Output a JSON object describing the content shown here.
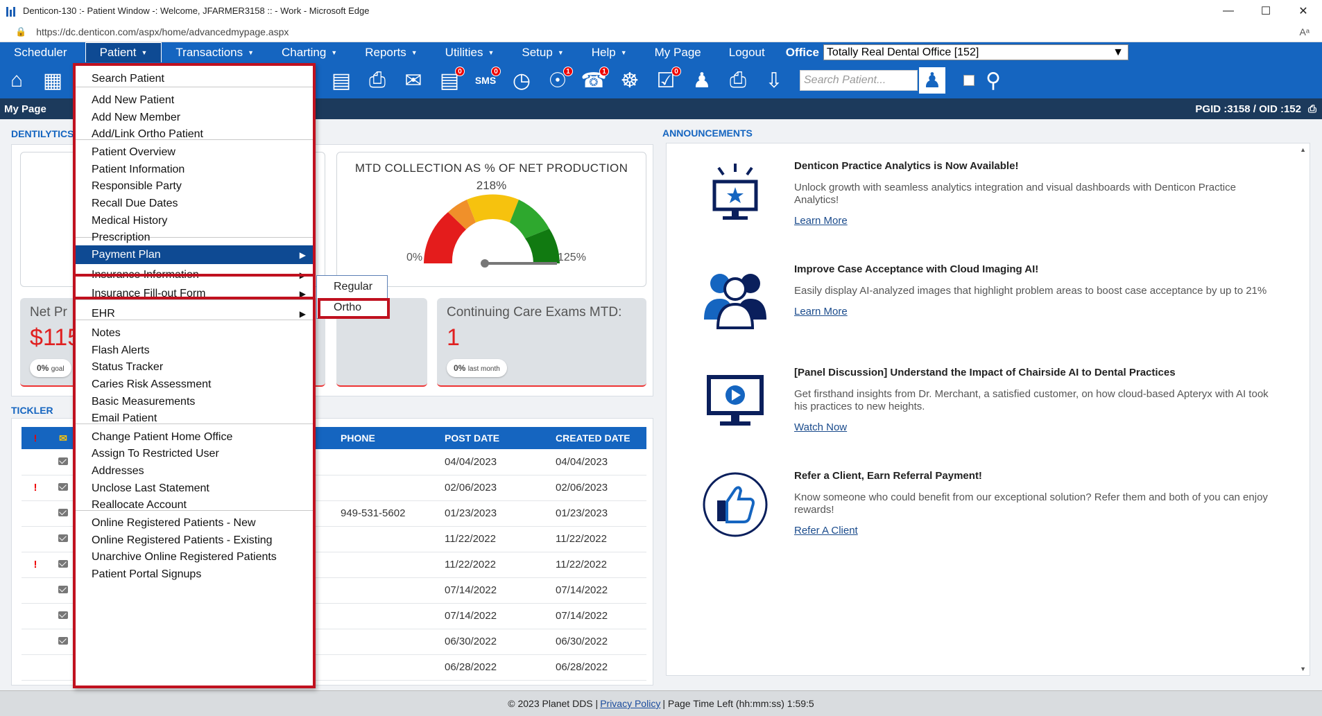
{
  "browser": {
    "title": "Denticon-130 :- Patient Window -: Welcome, JFARMER3158 :: - Work - Microsoft Edge",
    "url": "https://dc.denticon.com/aspx/home/advancedmypage.aspx",
    "min": "—",
    "max": "☐",
    "close": "✕",
    "read_aloud": "Aᵃ"
  },
  "menu": {
    "items": [
      {
        "label": "Scheduler"
      },
      {
        "label": "Patient",
        "caret": "▼"
      },
      {
        "label": "Transactions",
        "caret": "▼"
      },
      {
        "label": "Charting",
        "caret": "▼"
      },
      {
        "label": "Reports",
        "caret": "▼"
      },
      {
        "label": "Utilities",
        "caret": "▼"
      },
      {
        "label": "Setup",
        "caret": "▼"
      },
      {
        "label": "Help",
        "caret": "▼"
      },
      {
        "label": "My Page"
      },
      {
        "label": "Logout"
      }
    ],
    "office_label": "Office",
    "office_value": "Totally Real Dental Office [152]"
  },
  "toolbar": {
    "search_placeholder": "Search Patient...",
    "badges": {
      "sms": "0",
      "globe": "1",
      "support": "1",
      "list": "0",
      "msg": "0"
    },
    "sms_label": "SMS"
  },
  "header": {
    "title": "My Page",
    "ids": "PGID :3158  /  OID :152"
  },
  "sections": {
    "dentilytics": "DENTILYTICS",
    "tickler": "TICKLER",
    "announcements": "ANNOUNCEMENTS"
  },
  "gauge": {
    "title": "MTD COLLECTION AS % OF NET PRODUCTION",
    "value_label": "218%",
    "min_label": "0%",
    "max_label": "125%",
    "value_pct": 218,
    "max_pct": 125
  },
  "kpis": [
    {
      "label": "Net Pr",
      "value": "$115",
      "pill_pct": "0%",
      "pill_sub": "goal"
    },
    {
      "label": "Continuing Care Exams MTD:",
      "value": "1",
      "pill_pct": "0%",
      "pill_sub": "last month"
    }
  ],
  "tickler": {
    "columns": [
      "PHONE",
      "POST DATE",
      "CREATED DATE"
    ],
    "rows": [
      {
        "flag": "",
        "phone": "",
        "post": "04/04/2023",
        "created": "04/04/2023"
      },
      {
        "flag": "!",
        "phone": "",
        "post": "02/06/2023",
        "created": "02/06/2023"
      },
      {
        "flag": "",
        "phone": "949-531-5602",
        "post": "01/23/2023",
        "created": "01/23/2023"
      },
      {
        "flag": "",
        "phone": "",
        "post": "11/22/2022",
        "created": "11/22/2022"
      },
      {
        "flag": "!",
        "phone": "",
        "post": "11/22/2022",
        "created": "11/22/2022"
      },
      {
        "flag": "",
        "phone": "",
        "post": "07/14/2022",
        "created": "07/14/2022"
      },
      {
        "flag": "",
        "phone": "",
        "post": "07/14/2022",
        "created": "07/14/2022"
      },
      {
        "flag": "",
        "phone": "",
        "post": "06/30/2022",
        "created": "06/30/2022"
      }
    ],
    "partial_row": {
      "post": "06/28/2022",
      "created": "06/28/2022"
    }
  },
  "announcements": [
    {
      "title": "Denticon Practice Analytics is Now Available!",
      "desc": "Unlock growth with seamless analytics integration and visual dashboards with Denticon Practice Analytics!",
      "link": "Learn More",
      "icon": "monitor-star-icon"
    },
    {
      "title": "Improve Case Acceptance with Cloud Imaging AI!",
      "desc": "Easily display AI-analyzed images that highlight problem areas to boost case acceptance by up to 21%",
      "link": "Learn More",
      "icon": "people-group-icon"
    },
    {
      "title": "[Panel Discussion] Understand the Impact of Chairside AI to Dental Practices",
      "desc": "Get firsthand insights from Dr. Merchant, a satisfied customer, on how cloud-based Apteryx with AI took his practices to new heights.",
      "link": "Watch Now",
      "icon": "monitor-play-icon"
    },
    {
      "title": "Refer a Client, Earn Referral Payment!",
      "desc": "Know someone who could benefit from our exceptional solution? Refer them and both of you can enjoy rewards!",
      "link": "Refer A Client",
      "icon": "thumbs-up-icon"
    }
  ],
  "patient_menu": {
    "items": [
      {
        "label": "Search Patient"
      },
      {
        "label": "Add New Patient"
      },
      {
        "label": "Add New Member"
      },
      {
        "label": "Add/Link Ortho Patient"
      },
      {
        "label": "Patient Overview"
      },
      {
        "label": "Patient Information"
      },
      {
        "label": "Responsible Party"
      },
      {
        "label": "Recall Due Dates"
      },
      {
        "label": "Medical History"
      },
      {
        "label": "Prescription"
      },
      {
        "label": "Payment Plan",
        "arrow": "▶"
      },
      {
        "label": "Insurance Information",
        "arrow": "▶"
      },
      {
        "label": "Insurance Fill-out Form",
        "arrow": "▶"
      },
      {
        "label": "EHR",
        "arrow": "▶"
      },
      {
        "label": "Notes"
      },
      {
        "label": "Flash Alerts"
      },
      {
        "label": "Status Tracker"
      },
      {
        "label": "Caries Risk Assessment"
      },
      {
        "label": "Basic Measurements"
      },
      {
        "label": "Email Patient"
      },
      {
        "label": "Change Patient Home Office"
      },
      {
        "label": "Assign To Restricted User"
      },
      {
        "label": "Addresses"
      },
      {
        "label": "Unclose Last Statement"
      },
      {
        "label": "Reallocate Account"
      },
      {
        "label": "Online Registered Patients - New"
      },
      {
        "label": "Online Registered Patients - Existing"
      },
      {
        "label": "Unarchive Online Registered Patients"
      },
      {
        "label": "Patient Portal Signups"
      }
    ],
    "submenu": [
      {
        "label": "Regular"
      },
      {
        "label": "Ortho"
      }
    ]
  },
  "footer": {
    "copyright": "© 2023 Planet DDS |",
    "privacy": "Privacy Policy",
    "time": "| Page Time Left (hh:mm:ss) 1:59:5"
  },
  "colors": {
    "primary": "#1565c0",
    "header": "#1c3a5c",
    "highlight": "#c0111f",
    "alert": "#e02020"
  }
}
